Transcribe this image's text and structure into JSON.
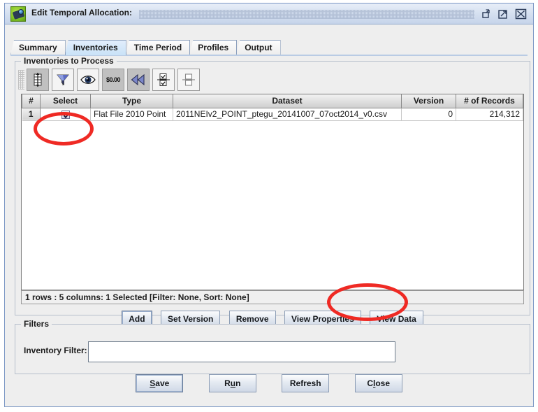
{
  "window": {
    "title": "Edit Temporal Allocation:",
    "icon": "telescope-icon",
    "controls": {
      "restore": "restore-down",
      "maximize": "maximize",
      "close": "close"
    }
  },
  "tabs": [
    {
      "label": "Summary",
      "active": false
    },
    {
      "label": "Inventories",
      "active": true
    },
    {
      "label": "Time Period",
      "active": false
    },
    {
      "label": "Profiles",
      "active": false
    },
    {
      "label": "Output",
      "active": false
    }
  ],
  "inventories_panel": {
    "title": "Inventories to Process",
    "toolbar": [
      {
        "name": "sort-columns-icon",
        "tooltip": "Sort"
      },
      {
        "name": "filter-funnel-icon",
        "tooltip": "Filter"
      },
      {
        "name": "eye-view-icon",
        "tooltip": "Show/Hide Columns"
      },
      {
        "name": "currency-format-icon",
        "label": "$0.00",
        "tooltip": "Format"
      },
      {
        "name": "rewind-icon",
        "tooltip": "Reset"
      },
      {
        "name": "select-all-icon",
        "tooltip": "Select All"
      },
      {
        "name": "clear-selection-icon",
        "tooltip": "Clear Selection"
      }
    ],
    "table": {
      "columns": [
        "#",
        "Select",
        "Type",
        "Dataset",
        "Version",
        "# of Records"
      ],
      "rows": [
        {
          "num": "1",
          "selected": true,
          "type": "Flat File 2010 Point",
          "dataset": "2011NEIv2_POINT_ptegu_20141007_07oct2014_v0.csv",
          "version": "0",
          "records": "214,312"
        }
      ],
      "status": "1 rows : 5 columns: 1 Selected [Filter: None, Sort: None]"
    },
    "buttons": [
      {
        "label": "Add",
        "focused": true
      },
      {
        "label": "Set Version",
        "focused": false
      },
      {
        "label": "Remove",
        "focused": false
      },
      {
        "label": "View Properties",
        "focused": false
      },
      {
        "label": "View Data",
        "focused": false
      }
    ]
  },
  "filters_panel": {
    "title": "Filters",
    "label": "Inventory Filter:",
    "value": "",
    "placeholder": ""
  },
  "bottom_buttons": [
    {
      "pre": "",
      "mnemonic": "S",
      "post": "ave"
    },
    {
      "pre": "R",
      "mnemonic": "u",
      "post": "n"
    },
    {
      "pre": "Refresh",
      "mnemonic": "",
      "post": ""
    },
    {
      "pre": "C",
      "mnemonic": "l",
      "post": "ose"
    }
  ],
  "annotations": [
    {
      "name": "highlight-select-checkbox",
      "color": "#ef2a24"
    },
    {
      "name": "highlight-view-data-button",
      "color": "#ef2a24"
    }
  ]
}
